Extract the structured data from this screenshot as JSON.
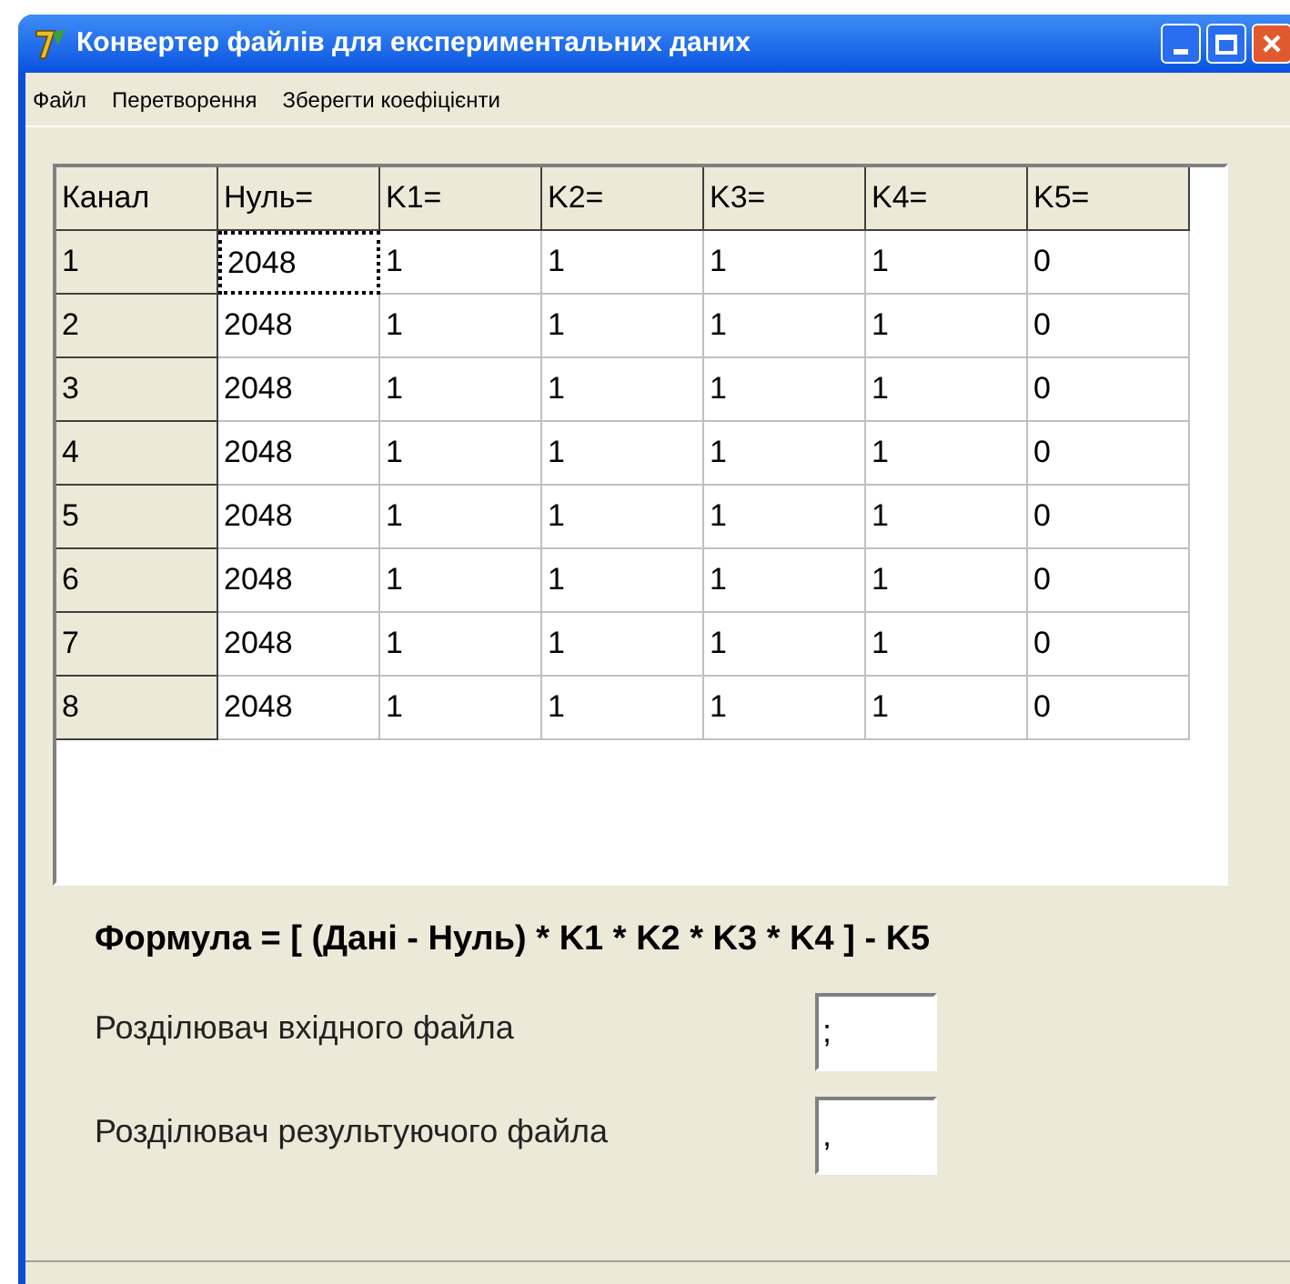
{
  "window": {
    "title": "Конвертер файлів для експериментальних даних"
  },
  "menu": [
    "Файл",
    "Перетворення",
    "Зберегти коефіцієнти"
  ],
  "table": {
    "columns": [
      "Канал",
      "Нуль=",
      "K1=",
      "K2=",
      "K3=",
      "K4=",
      "K5="
    ],
    "rows": [
      {
        "cells": [
          {
            "text": "1",
            "selected": false
          },
          {
            "text": "2048",
            "selected": true
          },
          {
            "text": "1",
            "selected": false
          },
          {
            "text": "1",
            "selected": false
          },
          {
            "text": "1",
            "selected": false
          },
          {
            "text": "1",
            "selected": false
          },
          {
            "text": "0",
            "selected": false
          }
        ]
      },
      {
        "cells": [
          {
            "text": "2",
            "selected": false
          },
          {
            "text": "2048",
            "selected": false
          },
          {
            "text": "1",
            "selected": false
          },
          {
            "text": "1",
            "selected": false
          },
          {
            "text": "1",
            "selected": false
          },
          {
            "text": "1",
            "selected": false
          },
          {
            "text": "0",
            "selected": false
          }
        ]
      },
      {
        "cells": [
          {
            "text": "3",
            "selected": false
          },
          {
            "text": "2048",
            "selected": false
          },
          {
            "text": "1",
            "selected": false
          },
          {
            "text": "1",
            "selected": false
          },
          {
            "text": "1",
            "selected": false
          },
          {
            "text": "1",
            "selected": false
          },
          {
            "text": "0",
            "selected": false
          }
        ]
      },
      {
        "cells": [
          {
            "text": "4",
            "selected": false
          },
          {
            "text": "2048",
            "selected": false
          },
          {
            "text": "1",
            "selected": false
          },
          {
            "text": "1",
            "selected": false
          },
          {
            "text": "1",
            "selected": false
          },
          {
            "text": "1",
            "selected": false
          },
          {
            "text": "0",
            "selected": false
          }
        ]
      },
      {
        "cells": [
          {
            "text": "5",
            "selected": false
          },
          {
            "text": "2048",
            "selected": false
          },
          {
            "text": "1",
            "selected": false
          },
          {
            "text": "1",
            "selected": false
          },
          {
            "text": "1",
            "selected": false
          },
          {
            "text": "1",
            "selected": false
          },
          {
            "text": "0",
            "selected": false
          }
        ]
      },
      {
        "cells": [
          {
            "text": "6",
            "selected": false
          },
          {
            "text": "2048",
            "selected": false
          },
          {
            "text": "1",
            "selected": false
          },
          {
            "text": "1",
            "selected": false
          },
          {
            "text": "1",
            "selected": false
          },
          {
            "text": "1",
            "selected": false
          },
          {
            "text": "0",
            "selected": false
          }
        ]
      },
      {
        "cells": [
          {
            "text": "7",
            "selected": false
          },
          {
            "text": "2048",
            "selected": false
          },
          {
            "text": "1",
            "selected": false
          },
          {
            "text": "1",
            "selected": false
          },
          {
            "text": "1",
            "selected": false
          },
          {
            "text": "1",
            "selected": false
          },
          {
            "text": "0",
            "selected": false
          }
        ]
      },
      {
        "cells": [
          {
            "text": "8",
            "selected": false
          },
          {
            "text": "2048",
            "selected": false
          },
          {
            "text": "1",
            "selected": false
          },
          {
            "text": "1",
            "selected": false
          },
          {
            "text": "1",
            "selected": false
          },
          {
            "text": "1",
            "selected": false
          },
          {
            "text": "0",
            "selected": false
          }
        ]
      }
    ]
  },
  "formula": "Формула = [ (Дані - Нуль) * K1 * K2 * K3 * K4 ] - K5",
  "fields": [
    {
      "label": "Розділювач вхідного файла",
      "value": ";"
    },
    {
      "label": "Розділювач результуючого файла",
      "value": ","
    }
  ]
}
